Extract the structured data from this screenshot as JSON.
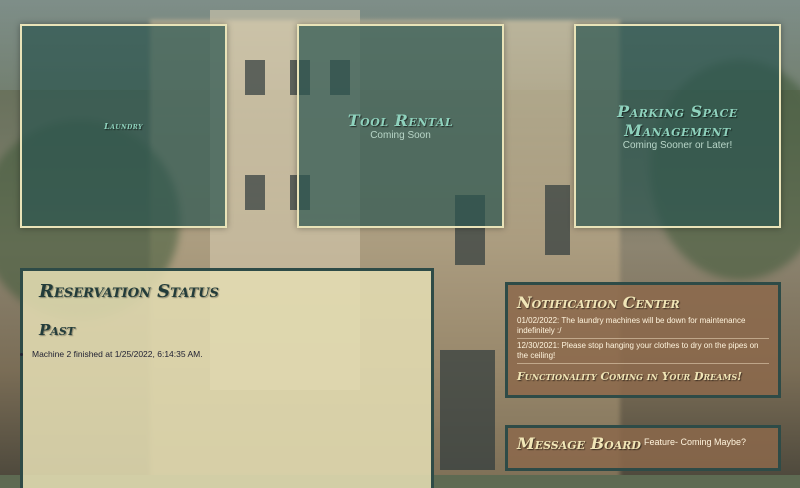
{
  "cards": [
    {
      "title": "Laundry",
      "subtitle": ""
    },
    {
      "title": "Tool Rental",
      "subtitle": "Coming Soon"
    },
    {
      "title": "Parking Space Management",
      "subtitle": "Coming Sooner or Later!"
    }
  ],
  "reservation": {
    "heading": "Reservation Status",
    "past_heading": "Past",
    "past_items": [
      "Machine 2 finished at 1/25/2022, 6:14:35 AM."
    ]
  },
  "notifications": {
    "heading": "Notification Center",
    "messages": [
      "01/02/2022: The laundry machines will be down for maintenance indefinitely :/",
      "12/30/2021: Please stop hanging your clothes to dry on the pipes on the ceiling!"
    ],
    "footer": "Functionality Coming in Your Dreams!"
  },
  "message_board": {
    "heading": "Message Board",
    "note": "Feature- Coming Maybe?"
  }
}
